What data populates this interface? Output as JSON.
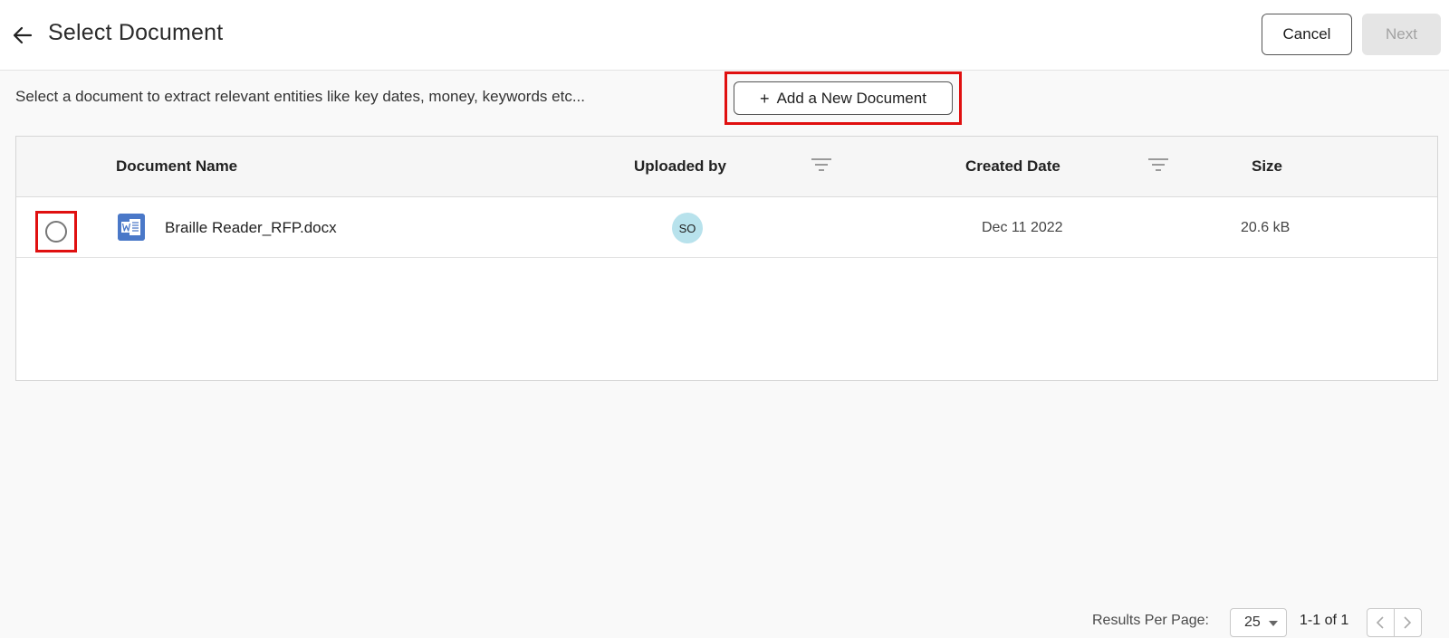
{
  "header": {
    "title": "Select Document",
    "back_icon": "arrow-left-icon",
    "cancel_label": "Cancel",
    "next_label": "Next"
  },
  "description": "Select a document to extract relevant entities like key dates, money, keywords etc...",
  "add_button": {
    "icon": "plus-icon",
    "label": "Add a New Document"
  },
  "table": {
    "columns": [
      "Document Name",
      "Uploaded by",
      "Created Date",
      "Size"
    ],
    "rows": [
      {
        "icon": "word-document-icon",
        "name": "Braille Reader_RFP.docx",
        "uploaded_by": "SO",
        "created_date": "Dec 11 2022",
        "size": "20.6 kB",
        "selected": false
      }
    ]
  },
  "pagination": {
    "results_label": "Results Per Page:",
    "per_page": "25",
    "range": "1-1 of 1"
  },
  "colors": {
    "highlight": "#e01010",
    "avatar_bg": "#b8e2ec",
    "doc_icon": "#4a78c8",
    "next_disabled_bg": "#e5e5e5"
  }
}
